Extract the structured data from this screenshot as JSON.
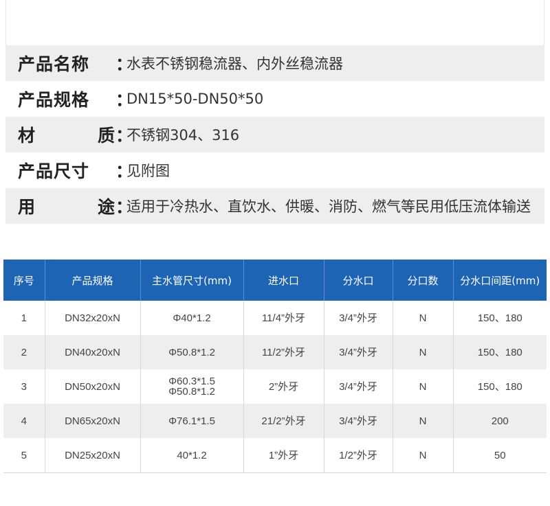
{
  "info": [
    {
      "label_a": "产品名称",
      "label_b": "",
      "value": "水表不锈钢稳流器、内外丝稳流器"
    },
    {
      "label_a": "产品规格",
      "label_b": "",
      "value": "DN15*50-DN50*50"
    },
    {
      "label_a": "材",
      "label_b": "质",
      "value": "不锈钢304、316"
    },
    {
      "label_a": "产品尺寸",
      "label_b": "",
      "value": "见附图"
    },
    {
      "label_a": "用",
      "label_b": "途",
      "value": "适用于冷热水、直饮水、供暖、消防、燃气等民用低压流体输送"
    }
  ],
  "colon": "：",
  "table": {
    "headers": [
      "序号",
      "产品规格",
      "主水管尺寸(mm)",
      "进水口",
      "分水口",
      "分口数",
      "分水口间距(mm)"
    ],
    "rows": [
      {
        "no": "1",
        "spec": "DN32x20xN",
        "main_a": "Φ40*1.2",
        "main_b": "",
        "inlet": "11/4”外牙",
        "outlet": "3/4”外牙",
        "count": "N",
        "spacing": "150、180"
      },
      {
        "no": "2",
        "spec": "DN40x20xN",
        "main_a": "Φ50.8*1.2",
        "main_b": "",
        "inlet": "11/2”外牙",
        "outlet": "3/4”外牙",
        "count": "N",
        "spacing": "150、180"
      },
      {
        "no": "3",
        "spec": "DN50x20xN",
        "main_a": "Φ60.3*1.5",
        "main_b": "Φ50.8*1.2",
        "inlet": "2”外牙",
        "outlet": "3/4”外牙",
        "count": "N",
        "spacing": "150、180"
      },
      {
        "no": "4",
        "spec": "DN65x20xN",
        "main_a": "Φ76.1*1.5",
        "main_b": "",
        "inlet": "21/2”外牙",
        "outlet": "3/4”外牙",
        "count": "N",
        "spacing": "200"
      },
      {
        "no": "5",
        "spec": "DN25x20xN",
        "main_a": "40*1.2",
        "main_b": "",
        "inlet": "1”外牙",
        "outlet": "1/2”外牙",
        "count": "N",
        "spacing": "50"
      }
    ]
  }
}
